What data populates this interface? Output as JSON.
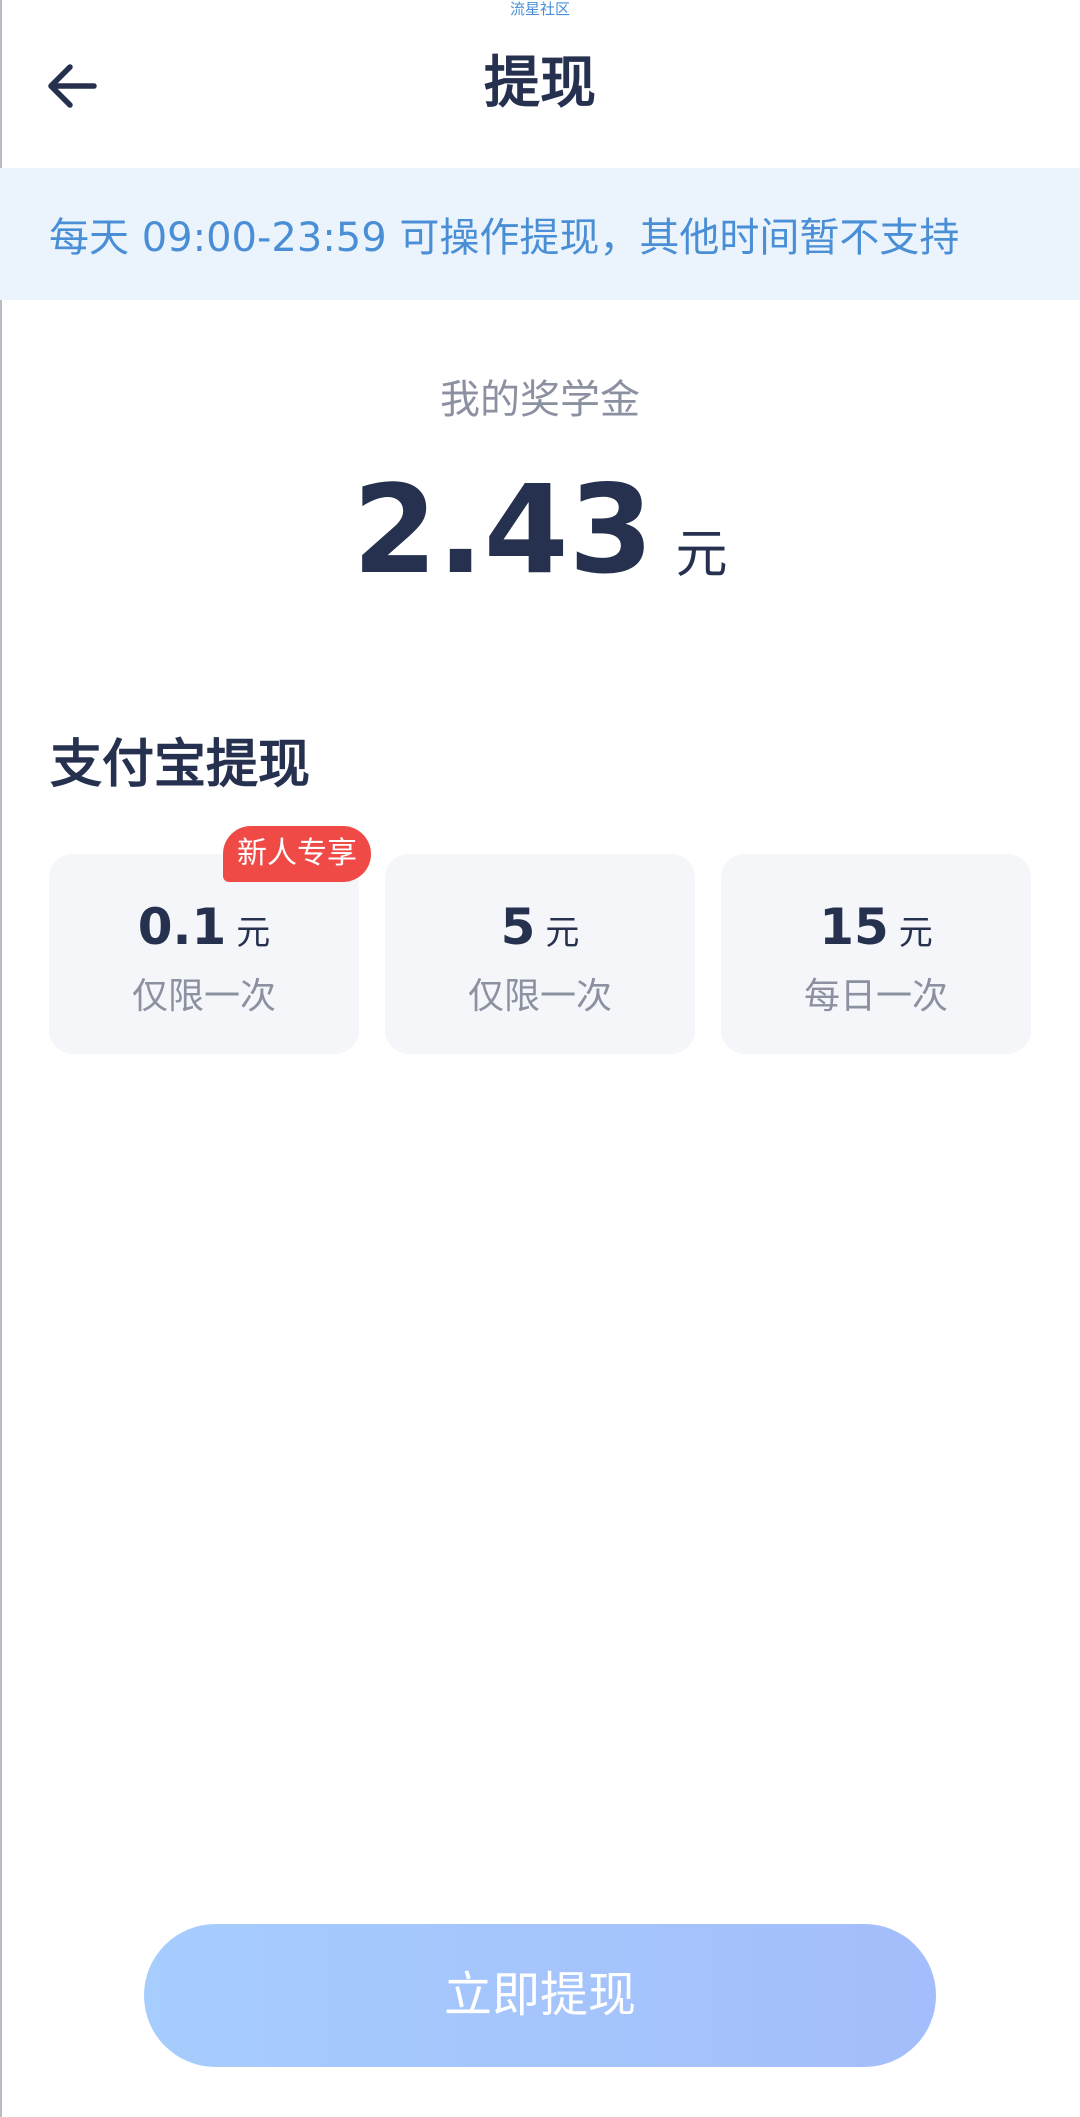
{
  "watermark": "流星社区",
  "header": {
    "title": "提现"
  },
  "notice": {
    "text": "每天 09:00-23:59 可操作提现，其他时间暂不支持"
  },
  "balance": {
    "label": "我的奖学金",
    "amount": "2.43",
    "unit": "元"
  },
  "section": {
    "title": "支付宝提现"
  },
  "options": [
    {
      "amount": "0.1",
      "unit": "元",
      "note": "仅限一次",
      "badge": "新人专享"
    },
    {
      "amount": "5",
      "unit": "元",
      "note": "仅限一次"
    },
    {
      "amount": "15",
      "unit": "元",
      "note": "每日一次"
    }
  ],
  "submit": {
    "label": "立即提现"
  },
  "icons": {
    "back": "arrow-left-icon"
  },
  "colors": {
    "primary_text": "#26314f",
    "muted_text": "#8b91a1",
    "notice_text": "#4a8fd6",
    "notice_bg": "#ebf4fd",
    "badge_bg": "#f04a47",
    "button_gradient_start": "#a6cdfd",
    "button_gradient_end": "#a4bdfc"
  }
}
